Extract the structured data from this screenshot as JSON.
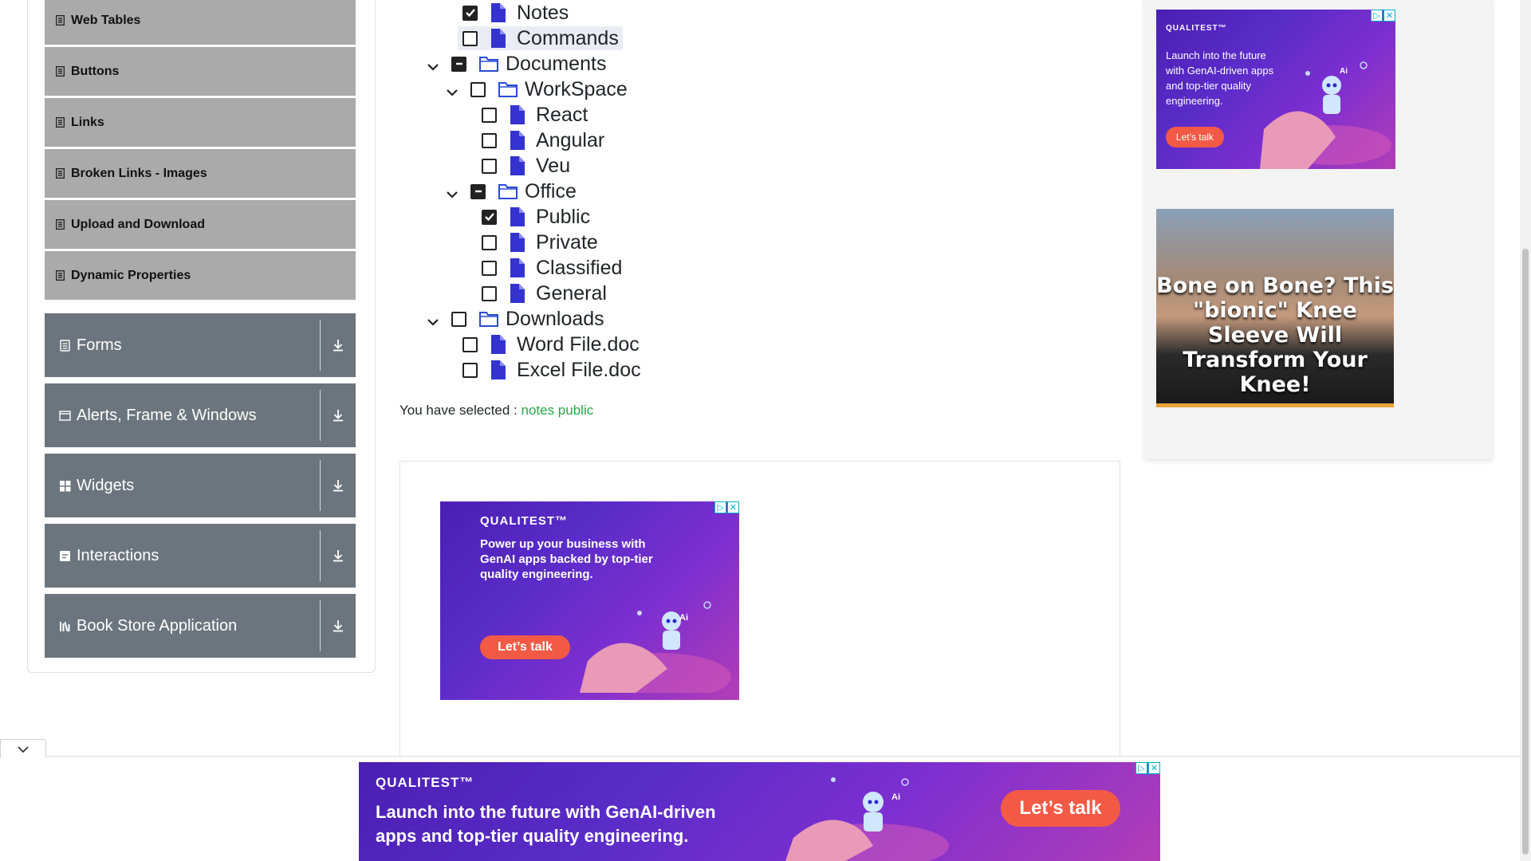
{
  "sidebar": {
    "sub_items": [
      {
        "label": "Web Tables",
        "icon": "list-icon"
      },
      {
        "label": "Buttons",
        "icon": "list-icon"
      },
      {
        "label": "Links",
        "icon": "list-icon"
      },
      {
        "label": "Broken Links - Images",
        "icon": "list-icon"
      },
      {
        "label": "Upload and Download",
        "icon": "list-icon"
      },
      {
        "label": "Dynamic Properties",
        "icon": "list-icon"
      }
    ],
    "groups": [
      {
        "label": "Forms",
        "icon": "form-icon"
      },
      {
        "label": "Alerts, Frame & Windows",
        "icon": "window-icon"
      },
      {
        "label": "Widgets",
        "icon": "grid-icon"
      },
      {
        "label": "Interactions",
        "icon": "interaction-icon"
      },
      {
        "label": "Book Store Application",
        "icon": "books-icon"
      }
    ]
  },
  "tree": {
    "notes": "Notes",
    "commands": "Commands",
    "documents": "Documents",
    "workspace": "WorkSpace",
    "react": "React",
    "angular": "Angular",
    "veu": "Veu",
    "office": "Office",
    "public": "Public",
    "private": "Private",
    "classified": "Classified",
    "general": "General",
    "downloads": "Downloads",
    "word": "Word File.doc",
    "excel": "Excel File.doc"
  },
  "result": {
    "prefix": "You have selected :",
    "values": "notes public"
  },
  "ads": {
    "brand": "QUALITEST™",
    "top_right_text": "Launch into the future with GenAI-driven apps and top-tier quality engineering.",
    "cta": "Let’s talk",
    "middle_text": "Power up your business with GenAI apps backed by top-tier quality engineering.",
    "bottom_text": "Launch into the future with GenAI-driven apps and top-tier quality engineering.",
    "knee_text": "Bone on Bone? This \"bionic\" Knee Sleeve Will Transform Your Knee!",
    "ai_label": "Ai"
  },
  "colors": {
    "sidebar_group_bg": "#6c757d",
    "sidebar_sub_bg": "#aaaaaa",
    "file_icon": "#3433d0",
    "folder_icon": "#2a4bd6",
    "selected_green": "#28a745",
    "cta_red": "#f25a45"
  }
}
